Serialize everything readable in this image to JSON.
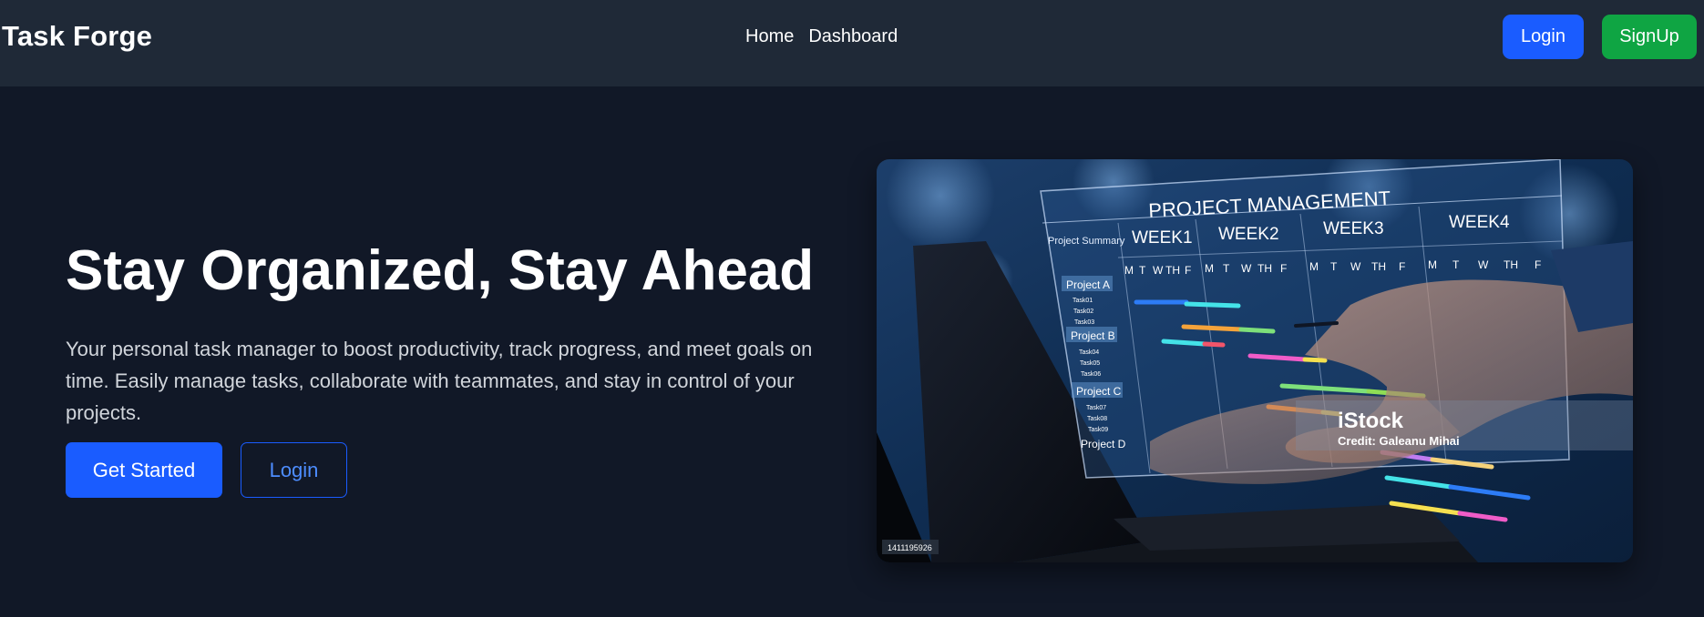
{
  "navbar": {
    "brand": "Task Forge",
    "links": [
      {
        "label": "Home"
      },
      {
        "label": "Dashboard"
      }
    ],
    "login_label": "Login",
    "signup_label": "SignUp",
    "colors": {
      "login": "#1a5cff",
      "signup": "#0fa543",
      "background": "#1f2937"
    }
  },
  "hero": {
    "title": "Stay Organized, Stay Ahead",
    "description": "Your personal task manager to boost productivity, track progress, and meet goals on time. Easily manage tasks, collaborate with teammates, and stay in control of your projects.",
    "primary_button": "Get Started",
    "secondary_button": "Login",
    "background": "#111827"
  },
  "image": {
    "board_title": "PROJECT MANAGEMENT",
    "summary_label": "Project Summary",
    "weeks": [
      "WEEK1",
      "WEEK2",
      "WEEK3",
      "WEEK4"
    ],
    "days": [
      "M",
      "T",
      "W",
      "TH",
      "F"
    ],
    "projects": [
      {
        "name": "Project A",
        "tasks": [
          "Task01",
          "Task02",
          "Task03"
        ]
      },
      {
        "name": "Project B",
        "tasks": [
          "Task04",
          "Task05",
          "Task06"
        ]
      },
      {
        "name": "Project C",
        "tasks": [
          "Task07",
          "Task08",
          "Task09"
        ]
      },
      {
        "name": "Project D",
        "tasks": []
      }
    ],
    "watermark_brand": "iStock",
    "watermark_credit": "Credit: Galeanu Mihai",
    "stock_id": "1411195926"
  }
}
